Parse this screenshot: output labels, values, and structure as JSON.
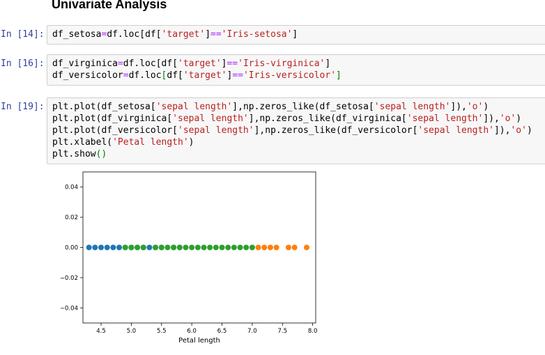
{
  "section": {
    "heading": "Univariate Analysis"
  },
  "cells": [
    {
      "prompt": "In [14]:",
      "lines": [
        [
          [
            "t",
            "df_setosa"
          ],
          [
            "o",
            "="
          ],
          [
            "t",
            "df.loc[df["
          ],
          [
            "s",
            "'target'"
          ],
          [
            "t",
            "]"
          ],
          [
            "o",
            "=="
          ],
          [
            "s",
            "'Iris-setosa'"
          ],
          [
            "t",
            "]"
          ]
        ]
      ]
    },
    {
      "prompt": "In [16]:",
      "lines": [
        [
          [
            "t",
            "df_virginica"
          ],
          [
            "o",
            "="
          ],
          [
            "t",
            "df.loc[df["
          ],
          [
            "s",
            "'target'"
          ],
          [
            "t",
            "]"
          ],
          [
            "o",
            "=="
          ],
          [
            "s",
            "'Iris-virginica'"
          ],
          [
            "t",
            "]"
          ]
        ],
        [
          [
            "t",
            "df_versicolor"
          ],
          [
            "o",
            "="
          ],
          [
            "t",
            "df.loc"
          ],
          [
            "b",
            "["
          ],
          [
            "t",
            "df["
          ],
          [
            "s",
            "'target'"
          ],
          [
            "t",
            "]"
          ],
          [
            "o",
            "=="
          ],
          [
            "s",
            "'Iris-versicolor'"
          ],
          [
            "b",
            "]"
          ]
        ]
      ]
    },
    {
      "prompt": "In [19]:",
      "lines": [
        [
          [
            "t",
            "plt.plot(df_setosa["
          ],
          [
            "s",
            "'sepal length'"
          ],
          [
            "t",
            "],np.zeros_like(df_setosa["
          ],
          [
            "s",
            "'sepal length'"
          ],
          [
            "t",
            "]),"
          ],
          [
            "s",
            "'o'"
          ],
          [
            "t",
            ")"
          ]
        ],
        [
          [
            "t",
            "plt.plot(df_virginica["
          ],
          [
            "s",
            "'sepal length'"
          ],
          [
            "t",
            "],np.zeros_like(df_virginica["
          ],
          [
            "s",
            "'sepal length'"
          ],
          [
            "t",
            "]),"
          ],
          [
            "s",
            "'o'"
          ],
          [
            "t",
            ")"
          ]
        ],
        [
          [
            "t",
            "plt.plot(df_versicolor["
          ],
          [
            "s",
            "'sepal length'"
          ],
          [
            "t",
            "],np.zeros_like(df_versicolor["
          ],
          [
            "s",
            "'sepal length'"
          ],
          [
            "t",
            "]),"
          ],
          [
            "s",
            "'o'"
          ],
          [
            "t",
            ")"
          ]
        ],
        [
          [
            "t",
            "plt.xlabel("
          ],
          [
            "s",
            "'Petal length'"
          ],
          [
            "t",
            ")"
          ]
        ],
        [
          [
            "t",
            "plt.show"
          ],
          [
            "b",
            "()"
          ]
        ]
      ]
    }
  ],
  "colors": {
    "setosa": "#1f77b4",
    "virginica": "#2ca02c",
    "versicolor": "#ff7f0e",
    "prompt": "#303f9f",
    "string": "#ba2121",
    "operator": "#aa22ff",
    "bracket": "#008000"
  },
  "chart_data": {
    "type": "scatter",
    "xlabel": "Petal length",
    "ylabel": "",
    "xlim": [
      4.2,
      8.05
    ],
    "ylim": [
      -0.05,
      0.05
    ],
    "xticks": [
      "4.5",
      "5.0",
      "5.5",
      "6.0",
      "6.5",
      "7.0",
      "7.5",
      "8.0"
    ],
    "yticks": [
      "0.04",
      "0.02",
      "0.00",
      "−0.02",
      "−0.04"
    ],
    "grid": false,
    "series": [
      {
        "color": "#1f77b4",
        "x": [
          4.3,
          4.4,
          4.5,
          4.6,
          4.7,
          4.8,
          4.9,
          5.0,
          5.1,
          5.2,
          5.3,
          5.4,
          5.5,
          5.7,
          5.8
        ],
        "y": [
          0,
          0,
          0,
          0,
          0,
          0,
          0,
          0,
          0,
          0,
          0,
          0,
          0,
          0,
          0
        ]
      },
      {
        "color": "#2ca02c",
        "x": [
          4.9,
          5.0,
          5.1,
          5.2,
          5.4,
          5.5,
          5.6,
          5.7,
          5.8,
          5.9,
          6.0,
          6.1,
          6.2,
          6.3,
          6.4,
          6.5,
          6.6,
          6.7,
          6.8,
          6.9,
          7.0
        ],
        "y": [
          0,
          0,
          0,
          0,
          0,
          0,
          0,
          0,
          0,
          0,
          0,
          0,
          0,
          0,
          0,
          0,
          0,
          0,
          0,
          0,
          0
        ]
      },
      {
        "color": "#ff7f0e",
        "x": [
          7.1,
          7.2,
          7.3,
          7.4,
          7.6,
          7.7,
          7.9
        ],
        "y": [
          0,
          0,
          0,
          0,
          0,
          0,
          0
        ]
      }
    ]
  }
}
